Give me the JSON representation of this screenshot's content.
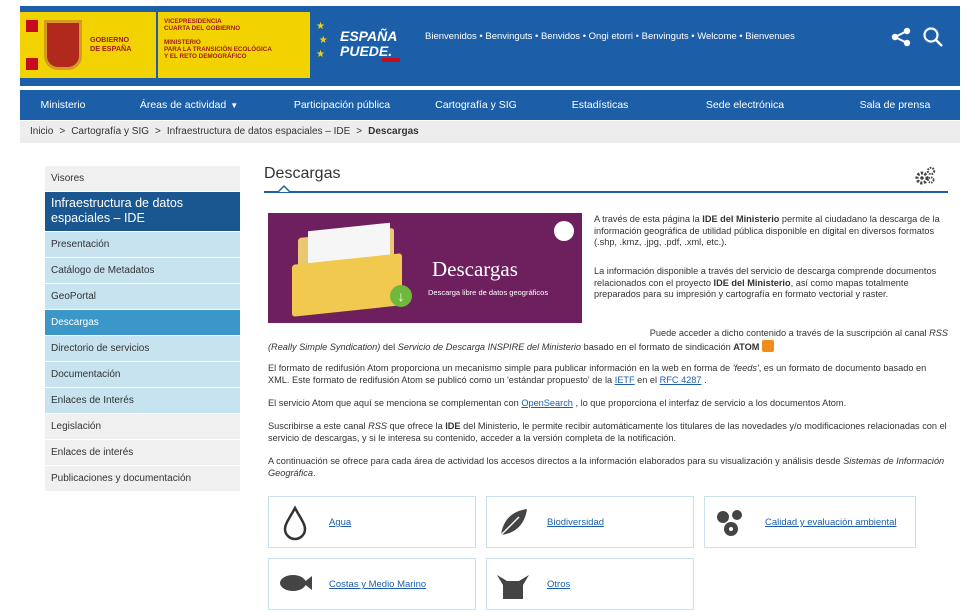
{
  "header": {
    "gov_text": "GOBIERNO\nDE ESPAÑA",
    "vice_lines": [
      "VICEPRESIDENCIA",
      "CUARTA DEL GOBIERNO",
      "",
      "MINISTERIO",
      "PARA LA TRANSICIÓN ECOLÓGICA",
      "Y EL RETO DEMOGRÁFICO"
    ],
    "campaign": "ESPAÑA\nPUEDE.",
    "welcome": "Bienvenidos • Benvinguts • Benvidos • Ongi etorri • Benvinguts • Welcome • Bienvenues",
    "icons": {
      "share": "share-icon",
      "search": "search-icon"
    }
  },
  "nav": {
    "items": [
      {
        "label": "Ministerio"
      },
      {
        "label": "Áreas de actividad"
      },
      {
        "label": "Participación pública"
      },
      {
        "label": "Cartografía y SIG"
      },
      {
        "label": "Estadísticas"
      },
      {
        "label": "Sede electrónica"
      },
      {
        "label": "Sala de prensa"
      }
    ]
  },
  "breadcrumb": {
    "items": [
      "Inicio",
      "Cartografía y SIG",
      "Infraestructura de datos espaciales – IDE",
      "Descargas"
    ],
    "separator": ">"
  },
  "sidebar": {
    "items": [
      {
        "label": "Visores"
      },
      {
        "label": "Infraestructura de datos espaciales – IDE"
      },
      {
        "label": "Presentación"
      },
      {
        "label": "Catálogo de Metadatos"
      },
      {
        "label": "GeoPortal"
      },
      {
        "label": "Descargas"
      },
      {
        "label": "Directorio de servicios"
      },
      {
        "label": "Documentación"
      },
      {
        "label": "Enlaces de Interés"
      },
      {
        "label": "Legislación"
      },
      {
        "label": "Enlaces de interés"
      },
      {
        "label": "Publicaciones y documentación"
      }
    ]
  },
  "content": {
    "title": "Descargas",
    "banner": {
      "title": "Descargas",
      "subtitle": "Descarga libre de datos geográficos"
    },
    "p1": {
      "a": "A través de esta página la ",
      "b": "IDE del Ministerio",
      "c": " permite al ciudadano la descarga de la información geográfica de utilidad pública disponible en digital en diversos formatos (.shp, .kmz, .jpg, .pdf, .xml, etc.)."
    },
    "p2": {
      "a": "La información disponible a través del servicio de descarga comprende documentos relacionados con el proyecto ",
      "b": "IDE del Ministerio",
      "c": ", así como mapas totalmente preparados para su impresión y cartografía en formato vectorial y raster."
    },
    "p3": {
      "a": "Puede acceder a dicho contenido a través de la suscripción al canal ",
      "b": "RSS",
      "c": "(Really Simple Syndication)",
      "d": " del ",
      "e": "Servicio de Descarga INSPIRE del Ministerio",
      "f": " basado en el formato de sindicación ",
      "g": "ATOM"
    },
    "p4": {
      "a": "El formato de redifusión Atom proporciona un mecanismo simple para publicar información en la web en forma de ",
      "b": "'feeds'",
      "c": ", es un formato de documento basado en XML. Este formato de redifusión Atom se publicó como un 'estándar propuesto' de la ",
      "d": "IETF",
      "e": " en el ",
      "f": "RFC 4287",
      "g": " ."
    },
    "p5": {
      "a": "El servicio Atom que aquí se menciona se complementan con ",
      "b": "OpenSearch",
      "c": " , lo que proporciona el interfaz de servicio a los documentos Atom."
    },
    "p6": {
      "a": "Suscribirse a este canal ",
      "b": "RSS",
      "c": " que ofrece la ",
      "d": "IDE",
      "e": " del Ministerio, le permite recibir automáticamente los titulares de las novedades y/o modificaciones relacionadas con el servicio de descargas, y si le interesa su contenido, acceder a la versión completa de la notificación."
    },
    "p7": {
      "a": "A continuación se ofrece para cada área de actividad los accesos directos a la información elaborados para su visualización y análisis desde ",
      "b": "Sistemas de Información Geográfica",
      "c": "."
    },
    "topics": [
      {
        "label": "Agua",
        "icon": "water-drop-icon"
      },
      {
        "label": "Biodiversidad",
        "icon": "leaf-icon"
      },
      {
        "label": "Calidad y evaluación ambiental",
        "icon": "flowers-icon"
      },
      {
        "label": "Costas y Medio Marino",
        "icon": "fish-icon"
      },
      {
        "label": "Otros",
        "icon": "box-icon"
      }
    ]
  },
  "colors": {
    "brand_blue": "#1c5fa8",
    "sidebar_dark": "#1a5790",
    "sidebar_active": "#3a97c8",
    "sidebar_light": "#c6e3ef",
    "banner_purple": "#6e1f5e"
  }
}
